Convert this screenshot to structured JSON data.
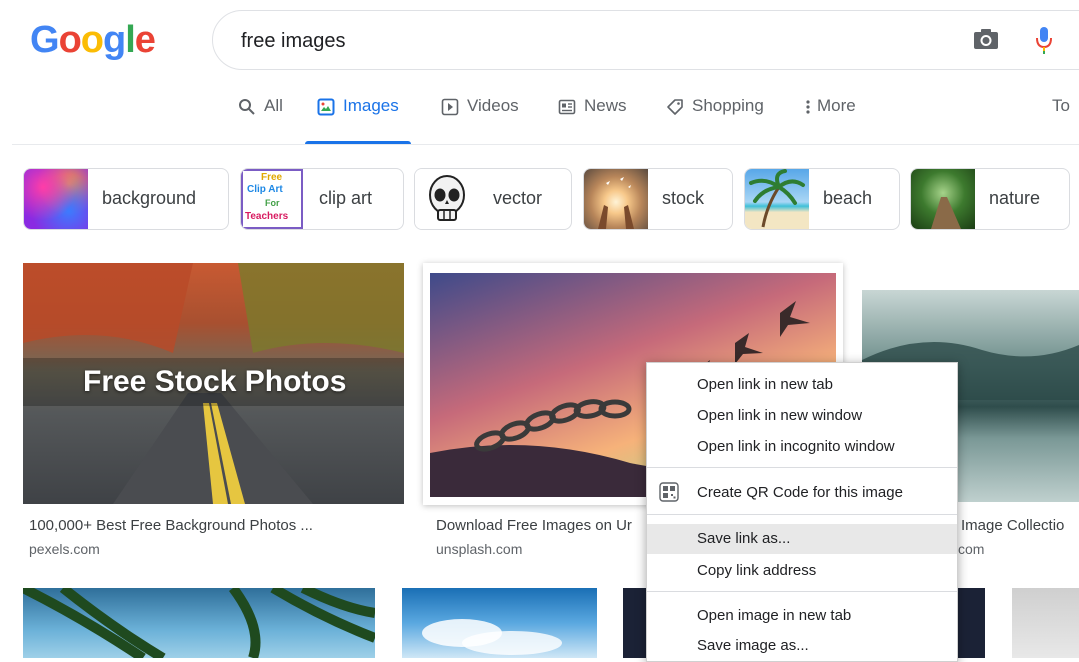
{
  "logo": {
    "letters": [
      "G",
      "o",
      "o",
      "g",
      "l",
      "e"
    ]
  },
  "search": {
    "query": "free images"
  },
  "tabs": [
    {
      "label": "All"
    },
    {
      "label": "Images"
    },
    {
      "label": "Videos"
    },
    {
      "label": "News"
    },
    {
      "label": "Shopping"
    },
    {
      "label": "More"
    },
    {
      "label": "To"
    }
  ],
  "chips": [
    {
      "label": "background"
    },
    {
      "label": "clip art",
      "thumb_text": [
        "Free",
        "Clip Art",
        "For",
        "Teachers"
      ]
    },
    {
      "label": "vector"
    },
    {
      "label": "stock"
    },
    {
      "label": "beach"
    },
    {
      "label": "nature"
    }
  ],
  "results": [
    {
      "overlay": "Free Stock Photos",
      "caption": "100,000+ Best Free Background Photos ...",
      "source": "pexels.com"
    },
    {
      "caption": "Download Free Images on Ur",
      "source": "unsplash.com"
    },
    {
      "caption": "Image Collectio",
      "source": "com"
    }
  ],
  "context_menu": {
    "items": [
      {
        "label": "Open link in new tab"
      },
      {
        "label": "Open link in new window"
      },
      {
        "label": "Open link in incognito window"
      },
      {
        "label": "Create QR Code for this image"
      },
      {
        "label": "Save link as..."
      },
      {
        "label": "Copy link address"
      },
      {
        "label": "Open image in new tab"
      },
      {
        "label": "Save image as..."
      }
    ]
  },
  "colors": {
    "blue": "#4285f4",
    "red": "#ea4335",
    "yellow": "#fbbc05",
    "green": "#34a853",
    "active_tab": "#1a73e8"
  }
}
